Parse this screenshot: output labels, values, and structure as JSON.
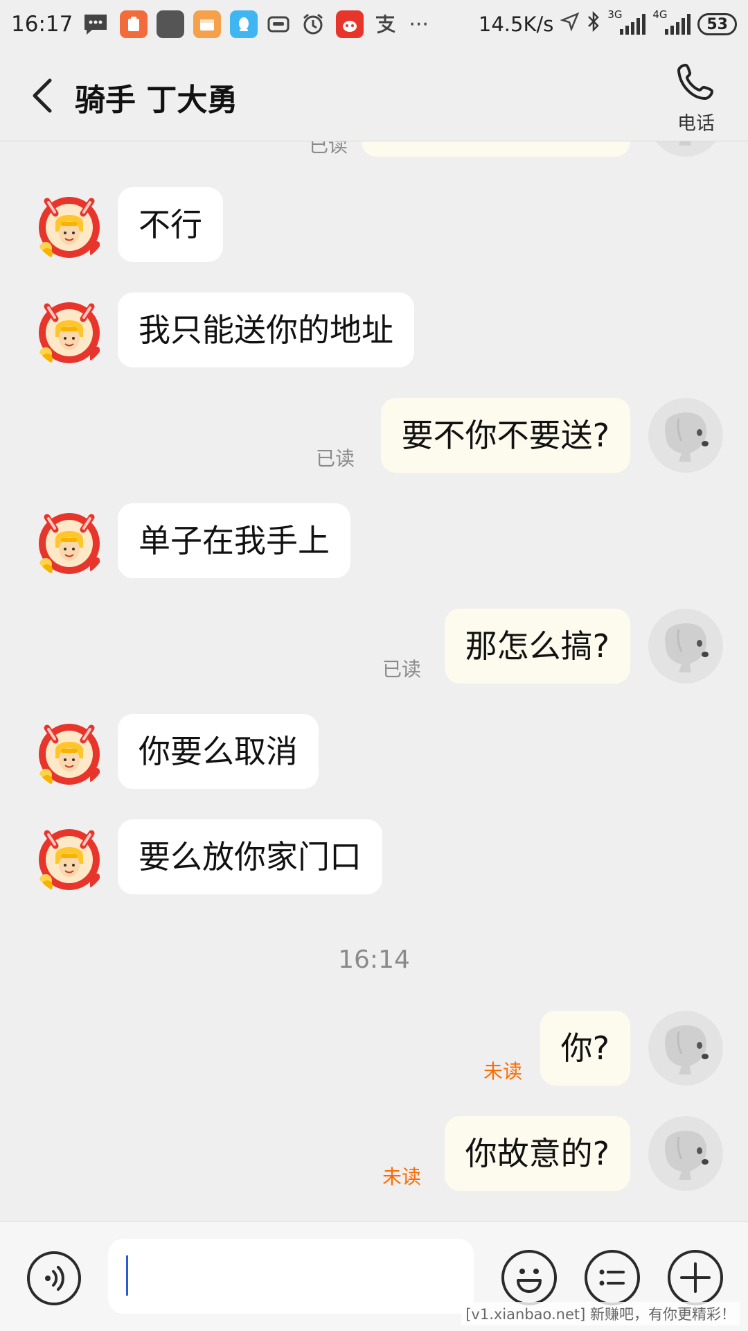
{
  "status_bar": {
    "time": "16:17",
    "net_speed": "14.5K/s",
    "sim1_type": "3G",
    "sim2_type": "4G",
    "battery": "53",
    "ellipsis": "···",
    "app_icons": [
      "message-icon",
      "clipboard-app-icon",
      "dark-app-icon",
      "calendar-app-icon",
      "qq-icon",
      "vr-icon",
      "alarm-icon",
      "red-app-icon",
      "alipay-icon"
    ]
  },
  "header": {
    "title": "骑手 丁大勇",
    "phone_label": "电话"
  },
  "messages": [
    {
      "from": "me",
      "text": "",
      "receipt": "已读"
    },
    {
      "from": "rider",
      "text": "不行"
    },
    {
      "from": "rider",
      "text": "我只能送你的地址"
    },
    {
      "from": "me",
      "text": "要不你不要送?",
      "receipt": "已读"
    },
    {
      "from": "rider",
      "text": "单子在我手上"
    },
    {
      "from": "me",
      "text": "那怎么搞?",
      "receipt": "已读"
    },
    {
      "from": "rider",
      "text": "你要么取消"
    },
    {
      "from": "rider",
      "text": "要么放你家门口"
    },
    {
      "from": "me",
      "text": "你?",
      "receipt": "未读"
    },
    {
      "from": "me",
      "text": "你故意的?",
      "receipt": "未读"
    }
  ],
  "timestamp": "16:14",
  "input": {
    "value": "",
    "placeholder": ""
  },
  "watermark": "[v1.xianbao.net] 新赚吧，有你更精彩！",
  "colors": {
    "background": "#efefef",
    "incoming_bubble": "#ffffff",
    "outgoing_bubble": "#fdfbee",
    "unread": "#ff6a00",
    "read": "#8a8a8a"
  }
}
